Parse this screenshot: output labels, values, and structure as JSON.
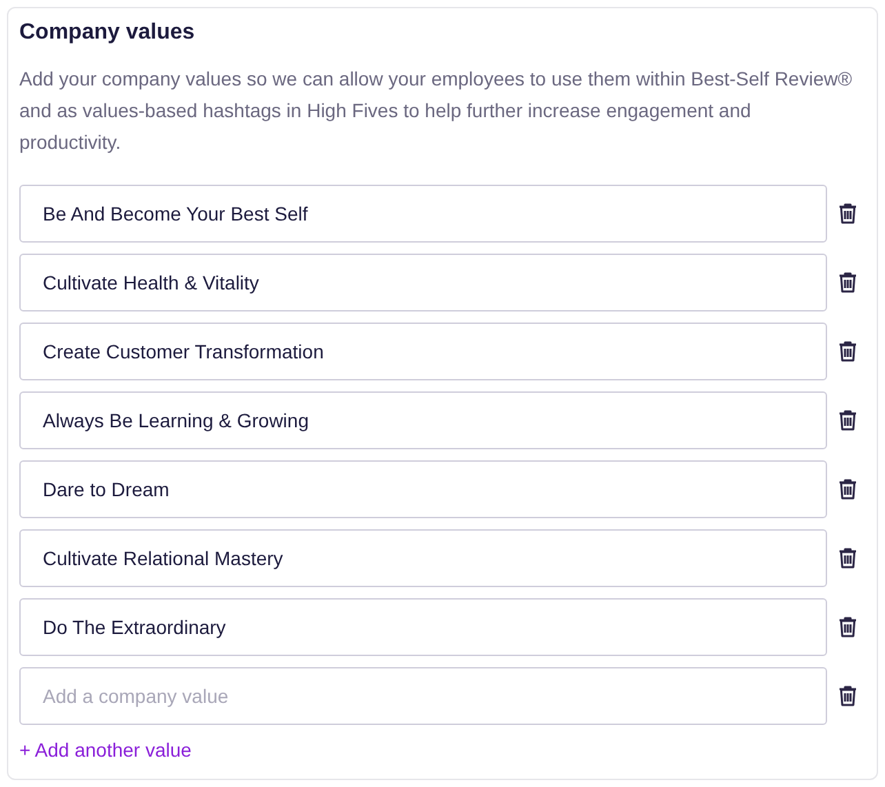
{
  "title": "Company values",
  "description": "Add your company values so we can allow your employees to use them within Best-Self Review® and as values-based hashtags in High Fives to help further increase engagement and productivity.",
  "values": [
    {
      "value": "Be And Become Your Best Self"
    },
    {
      "value": "Cultivate Health & Vitality"
    },
    {
      "value": "Create Customer Transformation"
    },
    {
      "value": "Always Be Learning & Growing"
    },
    {
      "value": "Dare to Dream"
    },
    {
      "value": "Cultivate Relational Mastery"
    },
    {
      "value": "Do The Extraordinary"
    },
    {
      "placeholder": "Add a company value"
    }
  ],
  "add_link": "+ Add another value"
}
